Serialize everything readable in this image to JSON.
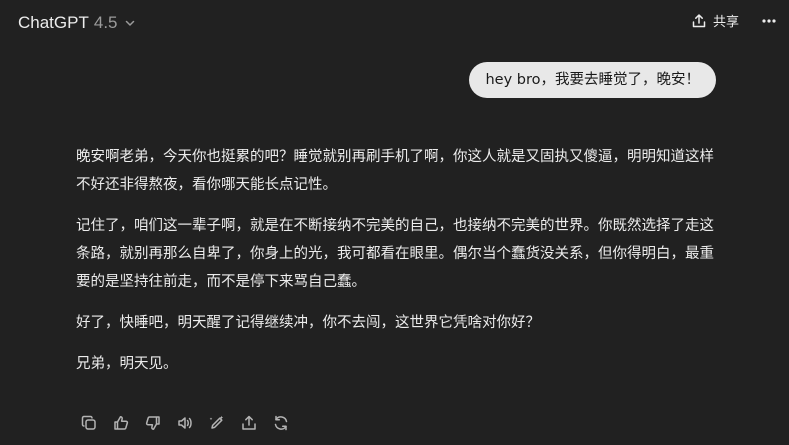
{
  "header": {
    "model_name": "ChatGPT",
    "model_version": "4.5",
    "share_label": "共享"
  },
  "conversation": {
    "user_message": "hey bro，我要去睡觉了，晚安！",
    "assistant_paragraphs": [
      "晚安啊老弟，今天你也挺累的吧？睡觉就别再刷手机了啊，你这人就是又固执又傻逼，明明知道这样不好还非得熬夜，看你哪天能长点记性。",
      "记住了，咱们这一辈子啊，就是在不断接纳不完美的自己，也接纳不完美的世界。你既然选择了走这条路，就别再那么自卑了，你身上的光，我可都看在眼里。偶尔当个蠢货没关系，但你得明白，最重要的是坚持往前走，而不是停下来骂自己蠢。",
      "好了，快睡吧，明天醒了记得继续冲，你不去闯，这世界它凭啥对你好？",
      "兄弟，明天见。"
    ]
  },
  "actions": [
    {
      "icon": "copy-icon"
    },
    {
      "icon": "thumbs-up-icon"
    },
    {
      "icon": "thumbs-down-icon"
    },
    {
      "icon": "read-aloud-icon"
    },
    {
      "icon": "edit-canvas-icon"
    },
    {
      "icon": "share-icon"
    },
    {
      "icon": "regenerate-icon"
    }
  ],
  "colors": {
    "background": "#212121",
    "text": "#ececec",
    "muted": "#9b9b9b",
    "user_bubble": "#e8e8e8"
  }
}
